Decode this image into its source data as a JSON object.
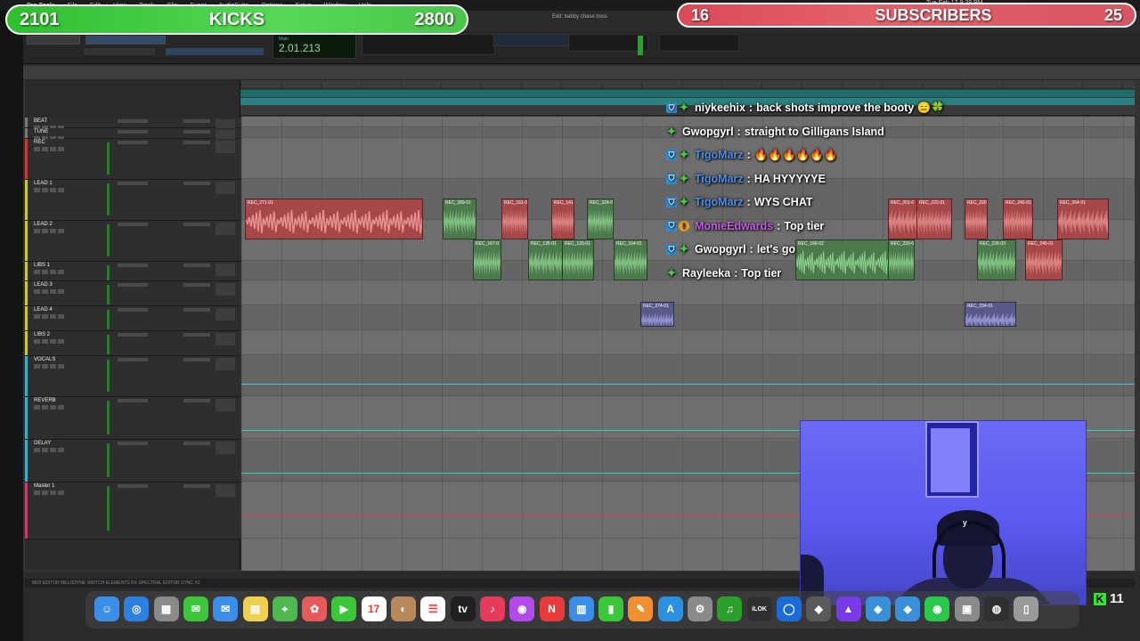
{
  "menubar": {
    "items": [
      "Pro Tools",
      "File",
      "Edit",
      "View",
      "Track",
      "Clip",
      "Event",
      "AudioSuite",
      "Options",
      "Setup",
      "Window",
      "Help"
    ],
    "clock": "Tue Feb 17 9:29 PM",
    "doc_title": "Edit: babby chase boss"
  },
  "overlay": {
    "kicks_left": "2101",
    "kicks_label": "KICKS",
    "kicks_goal": "2800",
    "subs_left": "16",
    "subs_label": "SUBSCRIBERS",
    "subs_goal": "25",
    "kick_viewers": "11",
    "kick_logo": "K"
  },
  "transport": {
    "counter": "2.01.213",
    "counter_caption": "Main"
  },
  "tracks": [
    {
      "name": "BEAT",
      "color": "#7a7a7a"
    },
    {
      "name": "TUNE",
      "color": "#7a7a7a"
    },
    {
      "name": "REC",
      "color": "#c83a3a"
    },
    {
      "name": "LEAD 1",
      "color": "#c8c83a"
    },
    {
      "name": "LEAD 2",
      "color": "#c8c83a"
    },
    {
      "name": "LIBS 1",
      "color": "#c8c83a"
    },
    {
      "name": "LEAD 3",
      "color": "#c8c83a"
    },
    {
      "name": "LEAD 4",
      "color": "#c8c83a"
    },
    {
      "name": "LIBS 2",
      "color": "#c8c83a"
    },
    {
      "name": "VOCALS",
      "color": "#3ab0c8"
    },
    {
      "name": "REVERB",
      "color": "#3ab0c8"
    },
    {
      "name": "DELAY",
      "color": "#3ab0c8"
    },
    {
      "name": "Master 1",
      "color": "#c83a6a"
    }
  ],
  "clips": [
    {
      "label": "REC_271-01"
    },
    {
      "label": "REC_289-01"
    },
    {
      "label": "REC_161-01"
    },
    {
      "label": "REC_141"
    },
    {
      "label": "REC_324-0"
    },
    {
      "label": "REC_201-0"
    },
    {
      "label": "REC_222-01"
    },
    {
      "label": "REC_220-"
    },
    {
      "label": "REC_242-01"
    },
    {
      "label": "REC_264-01"
    },
    {
      "label": "REC_167-0"
    },
    {
      "label": "REC_135-01"
    },
    {
      "label": "REC_120-01"
    },
    {
      "label": "REC_164-01"
    },
    {
      "label": "REC_166-02"
    },
    {
      "label": "REC_220-0"
    },
    {
      "label": "REC_226-03"
    },
    {
      "label": "REC_245-01"
    },
    {
      "label": "REC_274-01"
    },
    {
      "label": "REC_234-01"
    }
  ],
  "chat": [
    {
      "user": "niykeehix",
      "user_color": "#ffffff",
      "badges": [
        "shield",
        "star"
      ],
      "message": "back shots improve the booty 😑🍀"
    },
    {
      "user": "Gwopgyrl",
      "user_color": "#ffffff",
      "badges": [
        "star"
      ],
      "message": "straight to Gilligans Island"
    },
    {
      "user": "TigoMarz",
      "user_color": "#4a8fe8",
      "badges": [
        "shield",
        "star"
      ],
      "message": "🔥🔥🔥🔥🔥🔥"
    },
    {
      "user": "TigoMarz",
      "user_color": "#4a8fe8",
      "badges": [
        "shield",
        "star"
      ],
      "message": "HA HYYYYYE"
    },
    {
      "user": "TigoMarz",
      "user_color": "#4a8fe8",
      "badges": [
        "shield",
        "star"
      ],
      "message": "WYS CHAT"
    },
    {
      "user": "MonieEdwards",
      "user_color": "#c85ae8",
      "badges": [
        "shield",
        "mod"
      ],
      "message": "Top tier"
    },
    {
      "user": "Gwopgyrl",
      "user_color": "#ffffff",
      "badges": [
        "shield",
        "star"
      ],
      "message": "let's go"
    },
    {
      "user": "Rayleeka",
      "user_color": "#ffffff",
      "badges": [
        "star"
      ],
      "message": "Top tier"
    }
  ],
  "status_bar": {
    "label": "MIDI EDITOR    MELODYNE    SWITCH ELEMENTS    RX SPECTRAL EDITOR    SYNC X2"
  },
  "dock": [
    {
      "name": "Finder",
      "color": "#3a8ee8",
      "glyph": "☺"
    },
    {
      "name": "Safari",
      "color": "#2d7fe0",
      "glyph": "◎"
    },
    {
      "name": "Launchpad",
      "color": "#8a8a8a",
      "glyph": "▦"
    },
    {
      "name": "Messages",
      "color": "#3ac83a",
      "glyph": "✉"
    },
    {
      "name": "Mail",
      "color": "#3a8ee8",
      "glyph": "✉"
    },
    {
      "name": "Notes",
      "color": "#f0d050",
      "glyph": "▤"
    },
    {
      "name": "Maps",
      "color": "#50b850",
      "glyph": "⌖"
    },
    {
      "name": "Photos",
      "color": "#e85a5a",
      "glyph": "✿"
    },
    {
      "name": "FaceTime",
      "color": "#3ac83a",
      "glyph": "▶"
    },
    {
      "name": "Calendar",
      "color": "#ffffff",
      "glyph": "17"
    },
    {
      "name": "Contacts",
      "color": "#b88a5a",
      "glyph": "◐"
    },
    {
      "name": "Reminders",
      "color": "#ffffff",
      "glyph": "☰"
    },
    {
      "name": "TV",
      "color": "#202020",
      "glyph": "tv"
    },
    {
      "name": "Music",
      "color": "#e83a5a",
      "glyph": "♪"
    },
    {
      "name": "Podcasts",
      "color": "#b04ae8",
      "glyph": "◉"
    },
    {
      "name": "News",
      "color": "#e83a3a",
      "glyph": "N"
    },
    {
      "name": "Keynote",
      "color": "#3a8ee8",
      "glyph": "▥"
    },
    {
      "name": "Numbers",
      "color": "#3ac83a",
      "glyph": "▮"
    },
    {
      "name": "Pages",
      "color": "#f09030",
      "glyph": "✎"
    },
    {
      "name": "App Store",
      "color": "#2d8fe0",
      "glyph": "A"
    },
    {
      "name": "System Settings",
      "color": "#8a8a8a",
      "glyph": "⚙"
    },
    {
      "name": "Logic",
      "color": "#2aa02a",
      "glyph": "♫"
    },
    {
      "name": "iLok",
      "color": "#303030",
      "glyph": "iLOK"
    },
    {
      "name": "Pro Tools",
      "color": "#1a6ad8",
      "glyph": "◯"
    },
    {
      "name": "Plugin",
      "color": "#5a5a5a",
      "glyph": "◆"
    },
    {
      "name": "Antares",
      "color": "#7a3ae8",
      "glyph": "▲"
    },
    {
      "name": "Waves",
      "color": "#3a90d8",
      "glyph": "◈"
    },
    {
      "name": "Waves Central",
      "color": "#3a90d8",
      "glyph": "◈"
    },
    {
      "name": "Spotify",
      "color": "#2ac84a",
      "glyph": "◉"
    },
    {
      "name": "Network",
      "color": "#8a8a8a",
      "glyph": "▣"
    },
    {
      "name": "OBS",
      "color": "#303030",
      "glyph": "◍"
    },
    {
      "name": "Trash",
      "color": "#9a9a9a",
      "glyph": "▯"
    }
  ]
}
